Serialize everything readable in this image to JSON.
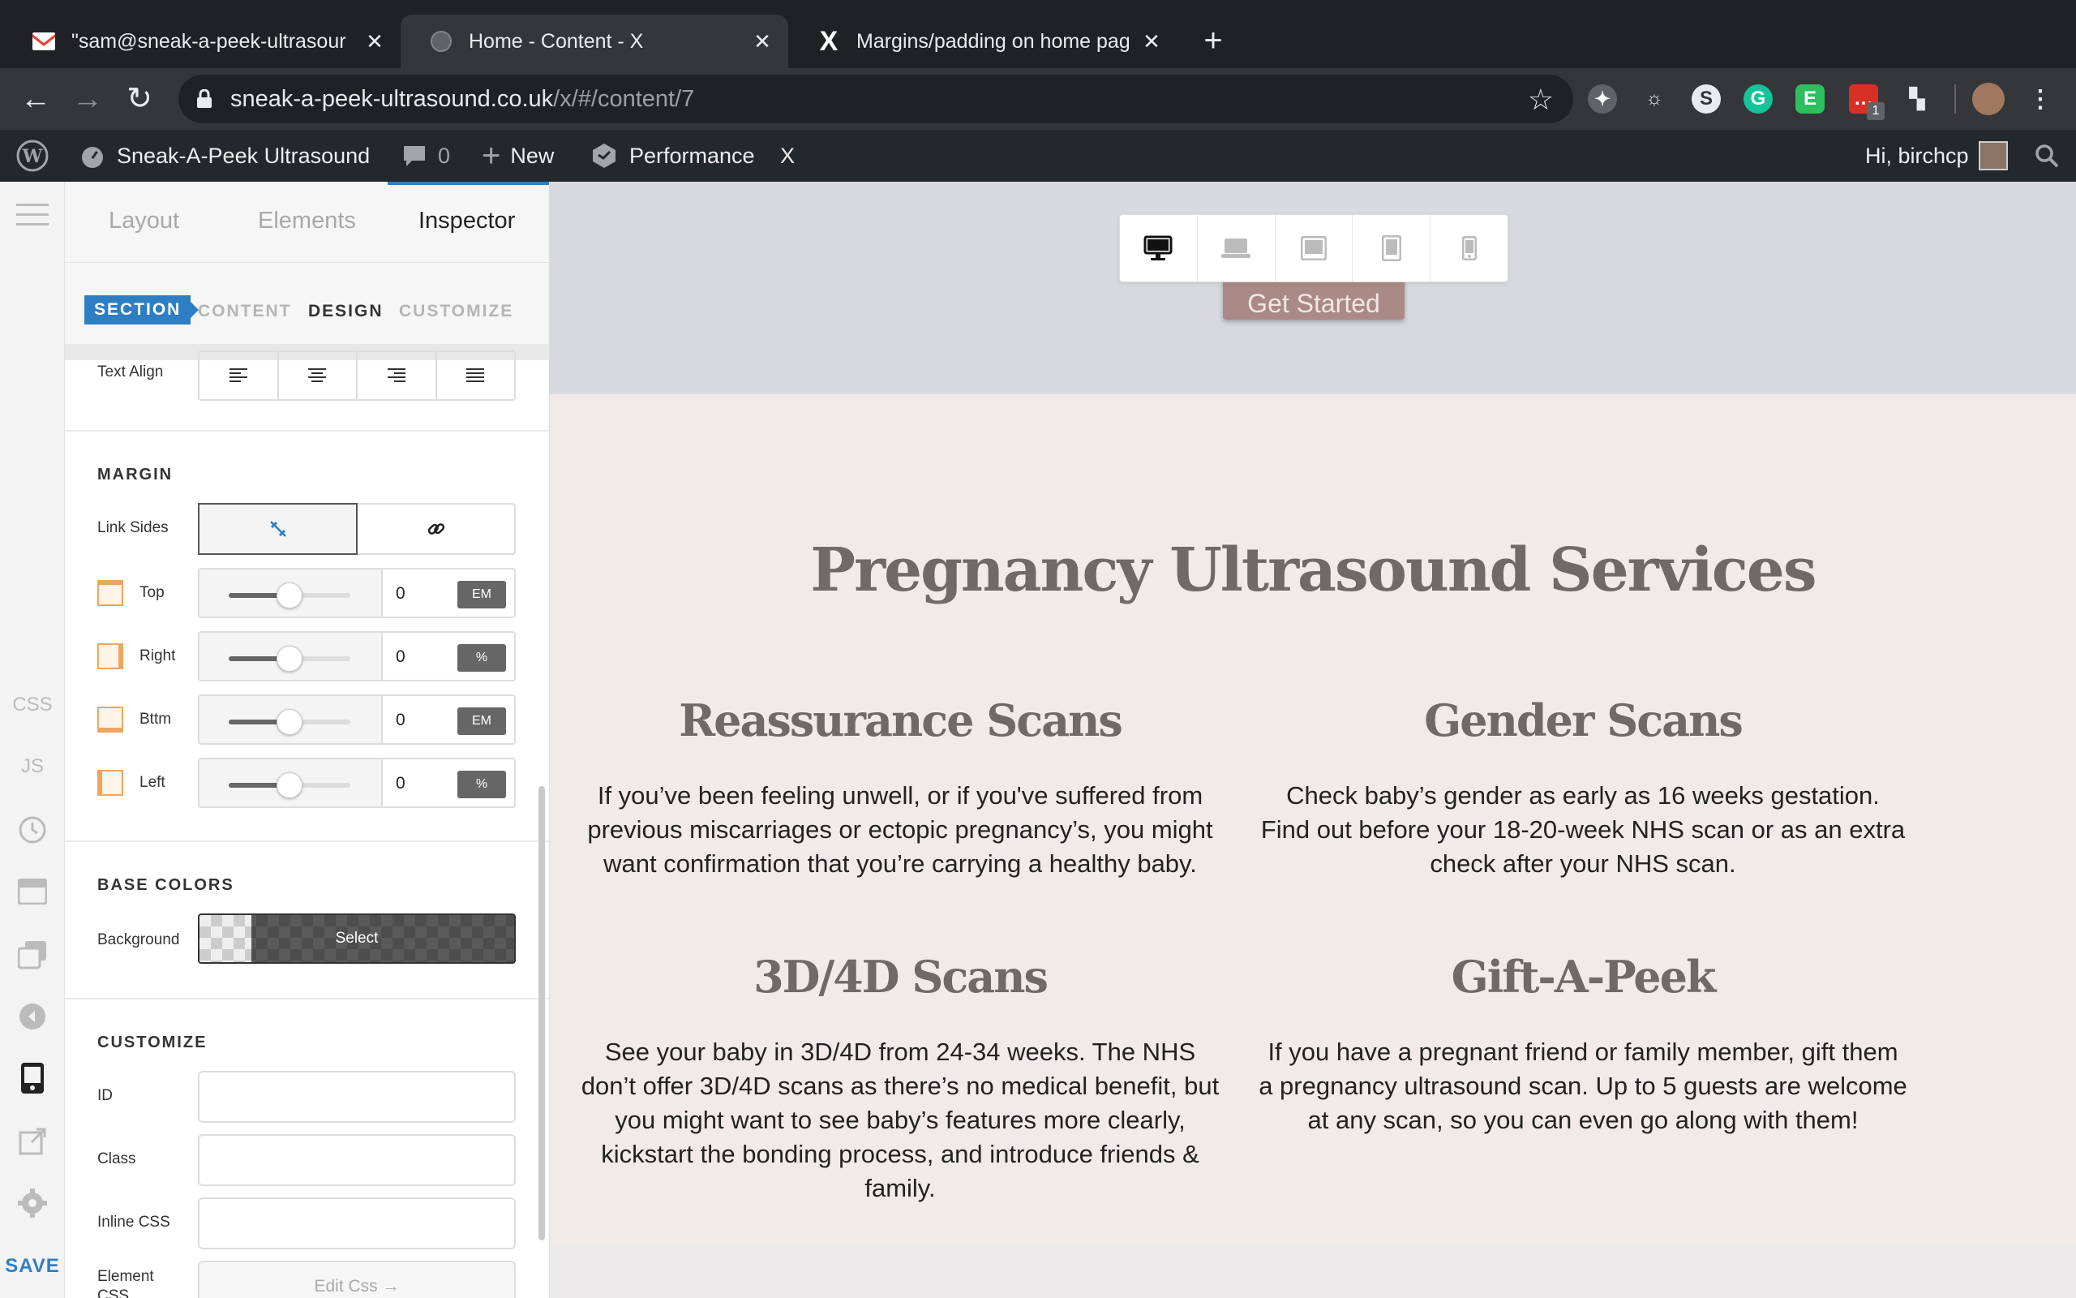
{
  "browser": {
    "tabs": [
      {
        "title": "\"sam@sneak-a-peek-ultrasour",
        "icon": "gmail-icon"
      },
      {
        "title": "Home - Content - X",
        "icon": "globe-icon"
      },
      {
        "title": "Margins/padding on home pag",
        "icon": "x-theme-icon"
      }
    ],
    "url_host": "sneak-a-peek-ultrasound.co.uk",
    "url_path": "/x/#/content/7",
    "extension_badge": "1"
  },
  "adminbar": {
    "site_name": "Sneak-A-Peek Ultrasound",
    "comments_count": "0",
    "new_label": "New",
    "performance_label": "Performance",
    "x_label": "X",
    "greeting": "Hi, birchcp"
  },
  "rail": {
    "css": "CSS",
    "js": "JS",
    "save": "SAVE"
  },
  "panel": {
    "tabs": [
      "Layout",
      "Elements",
      "Inspector"
    ],
    "breadcrumbs": [
      "SECTION",
      "CONTENT",
      "DESIGN",
      "CUSTOMIZE"
    ],
    "text_align_label": "Text Align",
    "margin_heading": "MARGIN",
    "link_sides_label": "Link Sides",
    "margins": [
      {
        "label": "Top",
        "value": "0",
        "unit": "EM",
        "slider": 0.5
      },
      {
        "label": "Right",
        "value": "0",
        "unit": "%",
        "slider": 0.5
      },
      {
        "label": "Bttm",
        "value": "0",
        "unit": "EM",
        "slider": 0.5
      },
      {
        "label": "Left",
        "value": "0",
        "unit": "%",
        "slider": 0.5
      }
    ],
    "base_colors_heading": "BASE COLORS",
    "background_label": "Background",
    "background_select": "Select",
    "customize_heading": "CUSTOMIZE",
    "id_label": "ID",
    "class_label": "Class",
    "inline_css_label": "Inline CSS",
    "element_css_label": "Element CSS",
    "edit_css": "Edit Css →"
  },
  "preview": {
    "cta_label": "Get Started",
    "heading": "Pregnancy Ultrasound Services",
    "services": [
      {
        "title": "Reassurance Scans",
        "text": "If you’ve been feeling unwell, or if you've suffered from previous miscarriages or ectopic pregnancy’s, you might want confirmation that you’re carrying a healthy baby."
      },
      {
        "title": "Gender Scans",
        "text": "Check baby’s gender as early as 16 weeks gestation. Find out before your 18-20-week NHS scan or as an extra check after your NHS scan."
      },
      {
        "title": "3D/4D Scans",
        "text": "See your baby in 3D/4D from 24-34 weeks. The NHS don’t offer 3D/4D scans as there’s no medical benefit, but you might want to see baby’s features more clearly, kickstart the bonding process, and introduce friends & family."
      },
      {
        "title": "Gift-A-Peek",
        "text": "If you have a pregnant friend or family member, gift them a pregnancy ultrasound scan. Up to 5 guests are welcome at any scan, so you can even go along with them!"
      }
    ]
  },
  "colors": {
    "accent": "#2e7ec4",
    "heading_text": "#6e6a69",
    "cta_bg": "#a98a87",
    "canvas_bg": "#f0ebe8"
  }
}
